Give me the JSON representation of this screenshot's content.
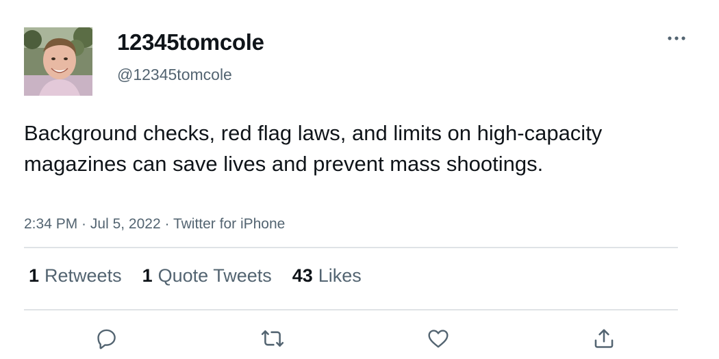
{
  "user": {
    "display_name": "12345tomcole",
    "handle": "@12345tomcole"
  },
  "tweet": {
    "text": "Background checks, red flag laws, and limits on high-capacity magazines can save lives and prevent mass shootings.",
    "time": "2:34 PM",
    "separator": " · ",
    "date": "Jul 5, 2022",
    "source": "Twitter for iPhone"
  },
  "stats": {
    "retweets_count": "1",
    "retweets_label": "Retweets",
    "quotes_count": "1",
    "quotes_label": "Quote Tweets",
    "likes_count": "43",
    "likes_label": "Likes"
  },
  "actions": {
    "reply_icon": "speech-bubble-icon",
    "retweet_icon": "retweet-arrows-icon",
    "like_icon": "heart-outline-icon",
    "share_icon": "share-upload-icon"
  },
  "colors": {
    "text": "#0f1419",
    "secondary": "#536471",
    "divider": "#dfe3e6",
    "background": "#ffffff"
  }
}
